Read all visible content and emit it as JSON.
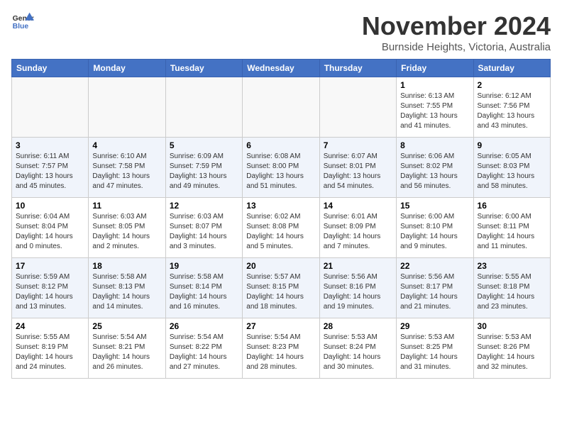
{
  "header": {
    "logo_general": "General",
    "logo_blue": "Blue",
    "month_title": "November 2024",
    "subtitle": "Burnside Heights, Victoria, Australia"
  },
  "days_of_week": [
    "Sunday",
    "Monday",
    "Tuesday",
    "Wednesday",
    "Thursday",
    "Friday",
    "Saturday"
  ],
  "weeks": [
    [
      {
        "day": "",
        "info": ""
      },
      {
        "day": "",
        "info": ""
      },
      {
        "day": "",
        "info": ""
      },
      {
        "day": "",
        "info": ""
      },
      {
        "day": "",
        "info": ""
      },
      {
        "day": "1",
        "info": "Sunrise: 6:13 AM\nSunset: 7:55 PM\nDaylight: 13 hours and 41 minutes."
      },
      {
        "day": "2",
        "info": "Sunrise: 6:12 AM\nSunset: 7:56 PM\nDaylight: 13 hours and 43 minutes."
      }
    ],
    [
      {
        "day": "3",
        "info": "Sunrise: 6:11 AM\nSunset: 7:57 PM\nDaylight: 13 hours and 45 minutes."
      },
      {
        "day": "4",
        "info": "Sunrise: 6:10 AM\nSunset: 7:58 PM\nDaylight: 13 hours and 47 minutes."
      },
      {
        "day": "5",
        "info": "Sunrise: 6:09 AM\nSunset: 7:59 PM\nDaylight: 13 hours and 49 minutes."
      },
      {
        "day": "6",
        "info": "Sunrise: 6:08 AM\nSunset: 8:00 PM\nDaylight: 13 hours and 51 minutes."
      },
      {
        "day": "7",
        "info": "Sunrise: 6:07 AM\nSunset: 8:01 PM\nDaylight: 13 hours and 54 minutes."
      },
      {
        "day": "8",
        "info": "Sunrise: 6:06 AM\nSunset: 8:02 PM\nDaylight: 13 hours and 56 minutes."
      },
      {
        "day": "9",
        "info": "Sunrise: 6:05 AM\nSunset: 8:03 PM\nDaylight: 13 hours and 58 minutes."
      }
    ],
    [
      {
        "day": "10",
        "info": "Sunrise: 6:04 AM\nSunset: 8:04 PM\nDaylight: 14 hours and 0 minutes."
      },
      {
        "day": "11",
        "info": "Sunrise: 6:03 AM\nSunset: 8:05 PM\nDaylight: 14 hours and 2 minutes."
      },
      {
        "day": "12",
        "info": "Sunrise: 6:03 AM\nSunset: 8:07 PM\nDaylight: 14 hours and 3 minutes."
      },
      {
        "day": "13",
        "info": "Sunrise: 6:02 AM\nSunset: 8:08 PM\nDaylight: 14 hours and 5 minutes."
      },
      {
        "day": "14",
        "info": "Sunrise: 6:01 AM\nSunset: 8:09 PM\nDaylight: 14 hours and 7 minutes."
      },
      {
        "day": "15",
        "info": "Sunrise: 6:00 AM\nSunset: 8:10 PM\nDaylight: 14 hours and 9 minutes."
      },
      {
        "day": "16",
        "info": "Sunrise: 6:00 AM\nSunset: 8:11 PM\nDaylight: 14 hours and 11 minutes."
      }
    ],
    [
      {
        "day": "17",
        "info": "Sunrise: 5:59 AM\nSunset: 8:12 PM\nDaylight: 14 hours and 13 minutes."
      },
      {
        "day": "18",
        "info": "Sunrise: 5:58 AM\nSunset: 8:13 PM\nDaylight: 14 hours and 14 minutes."
      },
      {
        "day": "19",
        "info": "Sunrise: 5:58 AM\nSunset: 8:14 PM\nDaylight: 14 hours and 16 minutes."
      },
      {
        "day": "20",
        "info": "Sunrise: 5:57 AM\nSunset: 8:15 PM\nDaylight: 14 hours and 18 minutes."
      },
      {
        "day": "21",
        "info": "Sunrise: 5:56 AM\nSunset: 8:16 PM\nDaylight: 14 hours and 19 minutes."
      },
      {
        "day": "22",
        "info": "Sunrise: 5:56 AM\nSunset: 8:17 PM\nDaylight: 14 hours and 21 minutes."
      },
      {
        "day": "23",
        "info": "Sunrise: 5:55 AM\nSunset: 8:18 PM\nDaylight: 14 hours and 23 minutes."
      }
    ],
    [
      {
        "day": "24",
        "info": "Sunrise: 5:55 AM\nSunset: 8:19 PM\nDaylight: 14 hours and 24 minutes."
      },
      {
        "day": "25",
        "info": "Sunrise: 5:54 AM\nSunset: 8:21 PM\nDaylight: 14 hours and 26 minutes."
      },
      {
        "day": "26",
        "info": "Sunrise: 5:54 AM\nSunset: 8:22 PM\nDaylight: 14 hours and 27 minutes."
      },
      {
        "day": "27",
        "info": "Sunrise: 5:54 AM\nSunset: 8:23 PM\nDaylight: 14 hours and 28 minutes."
      },
      {
        "day": "28",
        "info": "Sunrise: 5:53 AM\nSunset: 8:24 PM\nDaylight: 14 hours and 30 minutes."
      },
      {
        "day": "29",
        "info": "Sunrise: 5:53 AM\nSunset: 8:25 PM\nDaylight: 14 hours and 31 minutes."
      },
      {
        "day": "30",
        "info": "Sunrise: 5:53 AM\nSunset: 8:26 PM\nDaylight: 14 hours and 32 minutes."
      }
    ]
  ]
}
